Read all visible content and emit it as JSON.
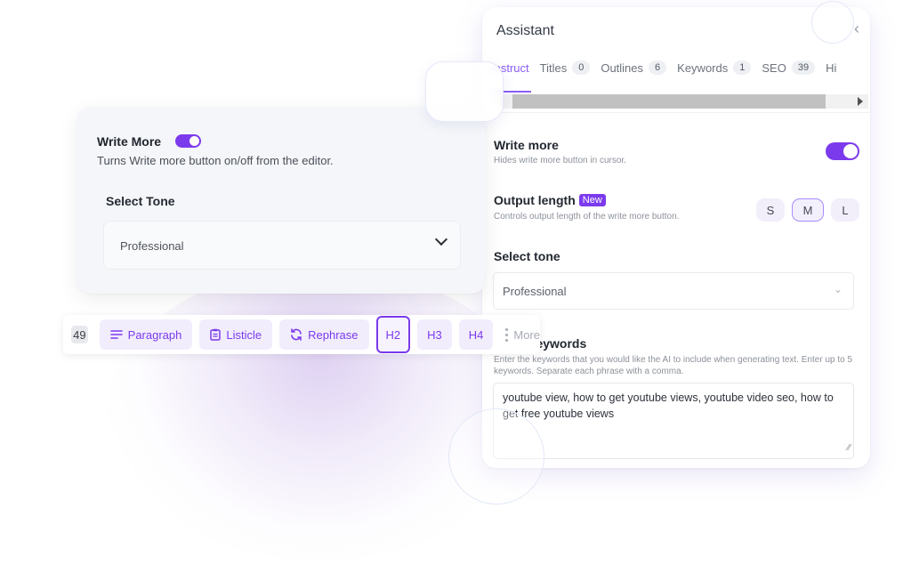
{
  "assistant": {
    "title": "Assistant",
    "close_icon": "chevron-left",
    "tabs": [
      {
        "label": "Instruct",
        "count": null,
        "active": true
      },
      {
        "label": "Titles",
        "count": "0"
      },
      {
        "label": "Outlines",
        "count": "6"
      },
      {
        "label": "Keywords",
        "count": "1"
      },
      {
        "label": "SEO",
        "count": "39"
      },
      {
        "label": "Hi",
        "count": null
      }
    ],
    "write_more": {
      "title": "Write more",
      "subtitle": "Hides write more button in cursor.",
      "enabled": true
    },
    "output_length": {
      "title": "Output length",
      "badge": "New",
      "subtitle": "Controls output length of the write more button.",
      "options": [
        "S",
        "M",
        "L"
      ],
      "selected": "M"
    },
    "select_tone": {
      "title": "Select tone",
      "value": "Professional"
    },
    "keywords": {
      "title": "Enter keywords",
      "title_visible": "keywords",
      "description": "Enter the keywords that you would like the AI to include when generating text. Enter up to 5 keywords. Separate each phrase with a comma.",
      "value": "youtube view, how to get youtube views, youtube video seo, how to get free youtube views"
    }
  },
  "card": {
    "write_more_title": "Write More",
    "write_more_enabled": true,
    "write_more_subtitle": "Turns Write more button on/off from the editor.",
    "tone_label": "Select Tone",
    "tone_value": "Professional"
  },
  "toolbar": {
    "count": "49",
    "buttons": [
      {
        "label": "Paragraph",
        "icon": "lines-icon"
      },
      {
        "label": "Listicle",
        "icon": "clipboard-list-icon"
      },
      {
        "label": "Rephrase",
        "icon": "refresh-icon"
      },
      {
        "label": "H2",
        "active": true
      },
      {
        "label": "H3"
      },
      {
        "label": "H4"
      }
    ],
    "more_label": "More"
  },
  "colors": {
    "accent": "#7c3aed",
    "accent_light": "#f1edfd",
    "card_bg": "#f4f6f9"
  }
}
